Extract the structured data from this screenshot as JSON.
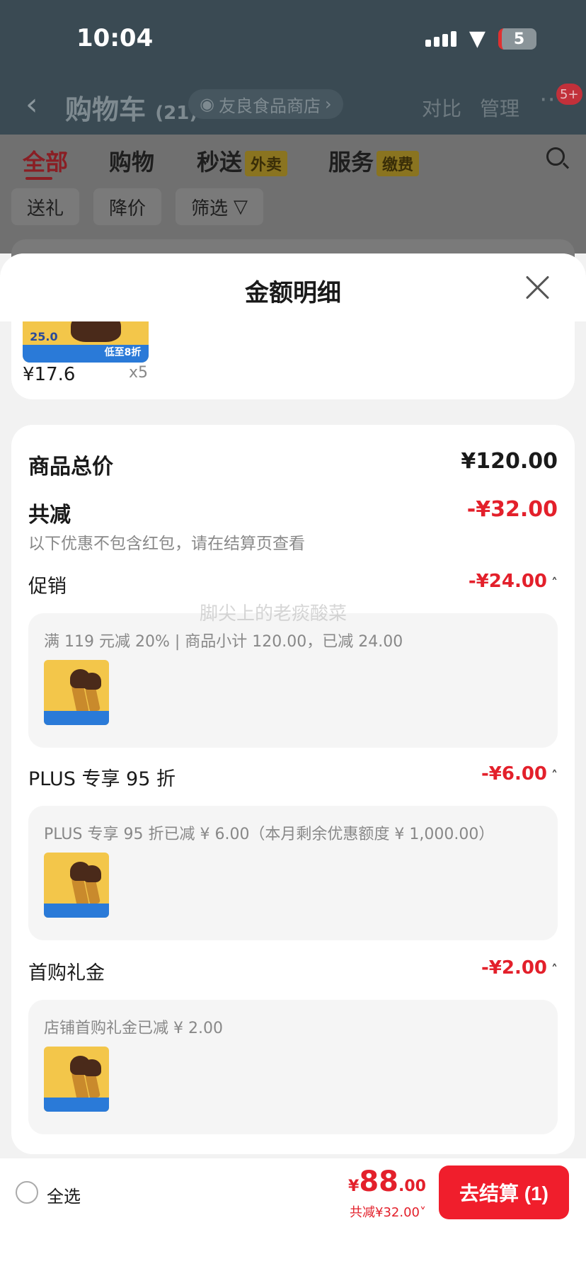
{
  "status_bar": {
    "time": "10:04",
    "battery": "5"
  },
  "nav": {
    "title": "购物车",
    "count": "(21)",
    "store": "友良食品商店",
    "compare": "对比",
    "manage": "管理",
    "more_badge": "5+"
  },
  "tabs": [
    {
      "label": "全部",
      "badge": ""
    },
    {
      "label": "购物",
      "badge": ""
    },
    {
      "label": "秒送",
      "badge": "外卖"
    },
    {
      "label": "服务",
      "badge": "缴费"
    }
  ],
  "filters": [
    "送礼",
    "降价",
    "筛选"
  ],
  "sheet": {
    "title": "金额明细"
  },
  "product": {
    "price": "¥17.6",
    "qty": "x5",
    "thumb_price": "25.0",
    "thumb_banner": "低至8折"
  },
  "summary": {
    "total_label": "商品总价",
    "total_value": "¥120.00",
    "discount_label": "共减",
    "discount_value": "-¥32.00",
    "discount_note": "以下优惠不包含红包，请在结算页查看"
  },
  "sections": [
    {
      "label": "促销",
      "amount": "-¥24.00",
      "detail": "满 119 元减 20% | 商品小计 120.00，已减 24.00"
    },
    {
      "label": "PLUS 专享 95 折",
      "amount": "-¥6.00",
      "detail": "PLUS 专享 95 折已减 ¥ 6.00（本月剩余优惠额度 ¥ 1,000.00）"
    },
    {
      "label": "首购礼金",
      "amount": "-¥2.00",
      "detail": "店铺首购礼金已减 ¥ 2.00"
    }
  ],
  "watermark": "脚尖上的老痰酸菜",
  "bottom_bar": {
    "select_all": "全选",
    "price_yen": "¥",
    "price_int": "88",
    "price_dec": ".00",
    "discount": "共减¥32.00",
    "checkout": "去结算 (1)"
  }
}
